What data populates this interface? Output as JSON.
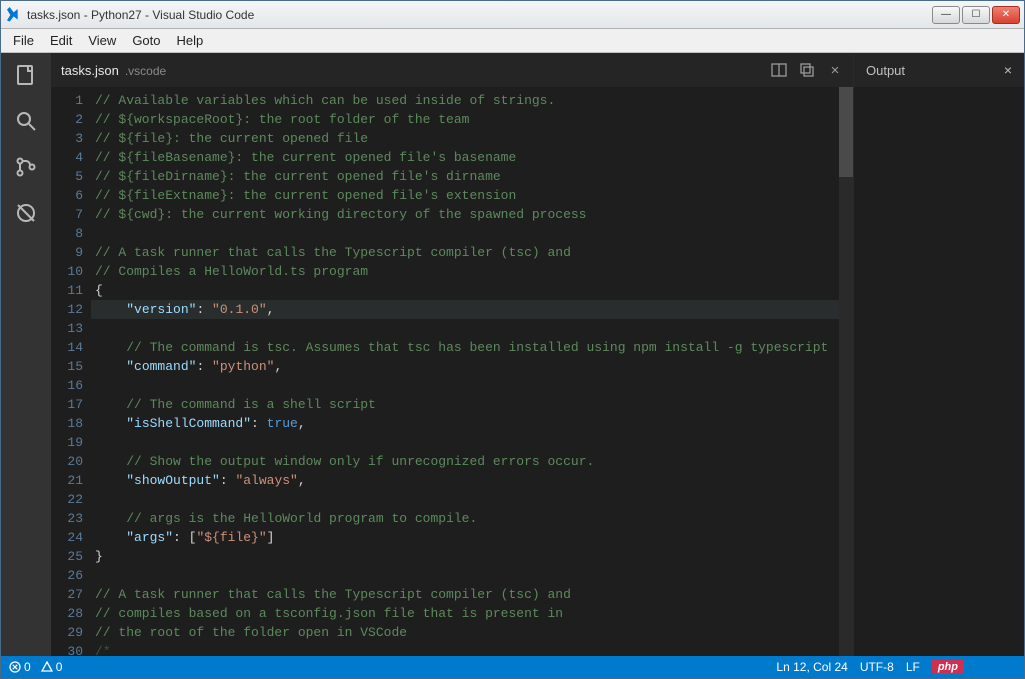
{
  "window": {
    "title": "tasks.json - Python27 - Visual Studio Code"
  },
  "menu": {
    "file": "File",
    "edit": "Edit",
    "view": "View",
    "goto": "Goto",
    "help": "Help"
  },
  "tab": {
    "filename": "tasks.json",
    "folder": ".vscode"
  },
  "output": {
    "title": "Output"
  },
  "status": {
    "errors": "0",
    "warnings": "0",
    "cursor": "Ln 12, Col 24",
    "encoding": "UTF-8",
    "eol": "LF",
    "lang": "php"
  },
  "code": {
    "highlight_line": 12,
    "lines": [
      {
        "n": 1,
        "t": "comment",
        "c": "// Available variables which can be used inside of strings."
      },
      {
        "n": 2,
        "t": "comment",
        "c": "// ${workspaceRoot}: the root folder of the team"
      },
      {
        "n": 3,
        "t": "comment",
        "c": "// ${file}: the current opened file"
      },
      {
        "n": 4,
        "t": "comment",
        "c": "// ${fileBasename}: the current opened file's basename"
      },
      {
        "n": 5,
        "t": "comment",
        "c": "// ${fileDirname}: the current opened file's dirname"
      },
      {
        "n": 6,
        "t": "comment",
        "c": "// ${fileExtname}: the current opened file's extension"
      },
      {
        "n": 7,
        "t": "comment",
        "c": "// ${cwd}: the current working directory of the spawned process"
      },
      {
        "n": 8,
        "t": "blank",
        "c": ""
      },
      {
        "n": 9,
        "t": "comment",
        "c": "// A task runner that calls the Typescript compiler (tsc) and"
      },
      {
        "n": 10,
        "t": "comment",
        "c": "// Compiles a HelloWorld.ts program"
      },
      {
        "n": 11,
        "t": "brace",
        "c": "{"
      },
      {
        "n": 12,
        "t": "kv",
        "indent": "    ",
        "key": "\"version\"",
        "sep": ": ",
        "val": "\"0.1.0\"",
        "tail": ","
      },
      {
        "n": 13,
        "t": "blank",
        "c": ""
      },
      {
        "n": 14,
        "t": "icomment",
        "indent": "    ",
        "c": "// The command is tsc. Assumes that tsc has been installed using npm install -g typescript"
      },
      {
        "n": 15,
        "t": "kv",
        "indent": "    ",
        "key": "\"command\"",
        "sep": ": ",
        "val": "\"python\"",
        "tail": ","
      },
      {
        "n": 16,
        "t": "blank",
        "c": ""
      },
      {
        "n": 17,
        "t": "icomment",
        "indent": "    ",
        "c": "// The command is a shell script"
      },
      {
        "n": 18,
        "t": "kvconst",
        "indent": "    ",
        "key": "\"isShellCommand\"",
        "sep": ": ",
        "val": "true",
        "tail": ","
      },
      {
        "n": 19,
        "t": "blank",
        "c": ""
      },
      {
        "n": 20,
        "t": "icomment",
        "indent": "    ",
        "c": "// Show the output window only if unrecognized errors occur."
      },
      {
        "n": 21,
        "t": "kv",
        "indent": "    ",
        "key": "\"showOutput\"",
        "sep": ": ",
        "val": "\"always\"",
        "tail": ","
      },
      {
        "n": 22,
        "t": "blank",
        "c": ""
      },
      {
        "n": 23,
        "t": "icomment",
        "indent": "    ",
        "c": "// args is the HelloWorld program to compile."
      },
      {
        "n": 24,
        "t": "kvarr",
        "indent": "    ",
        "key": "\"args\"",
        "sep": ": ",
        "open": "[",
        "val": "\"${file}\"",
        "close": "]"
      },
      {
        "n": 25,
        "t": "brace",
        "c": "}"
      },
      {
        "n": 26,
        "t": "blank",
        "c": ""
      },
      {
        "n": 27,
        "t": "comment",
        "c": "// A task runner that calls the Typescript compiler (tsc) and"
      },
      {
        "n": 28,
        "t": "comment",
        "c": "// compiles based on a tsconfig.json file that is present in"
      },
      {
        "n": 29,
        "t": "comment",
        "c": "// the root of the folder open in VSCode"
      },
      {
        "n": 30,
        "t": "dimcomment",
        "c": "/*"
      }
    ]
  }
}
